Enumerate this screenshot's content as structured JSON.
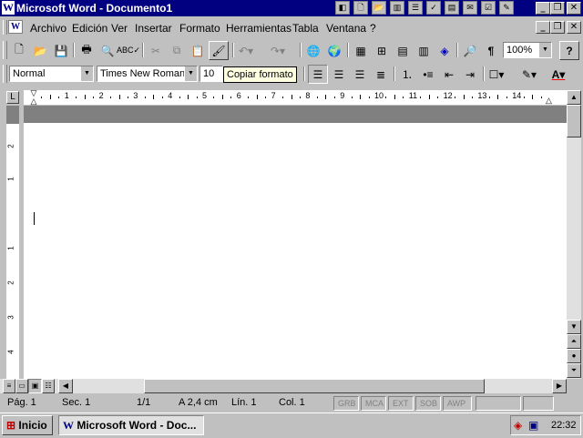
{
  "window": {
    "title": "Microsoft Word - Documento1",
    "icon": "W"
  },
  "office_bar_icons": [
    "office-logo-icon",
    "new-doc-icon",
    "open-icon",
    "binder-icon",
    "contact-icon",
    "note-icon",
    "task-icon",
    "journal-icon",
    "shortcut-icon",
    "folder-icon"
  ],
  "menu": {
    "items": [
      "Archivo",
      "Edición",
      "Ver",
      "Insertar",
      "Formato",
      "Herramientas",
      "Tabla",
      "Ventana",
      "?"
    ]
  },
  "standard_toolbar": {
    "zoom": "100%",
    "help_glyph": "?"
  },
  "format_toolbar": {
    "style": "Normal",
    "font": "Times New Roman",
    "size": "10"
  },
  "tooltip": "Copiar formato",
  "ruler": {
    "labels": [
      "1",
      "2",
      "3",
      "4",
      "5",
      "6",
      "7",
      "8",
      "9",
      "10",
      "11",
      "12",
      "13",
      "14"
    ],
    "vertical_labels": [
      "2",
      "1",
      "1",
      "2",
      "3",
      "4"
    ]
  },
  "statusbar": {
    "page": "Pág.  1",
    "section": "Sec.  1",
    "pages": "1/1",
    "position": "A  2,4 cm",
    "line": "Lín.  1",
    "column": "Col.  1",
    "modes": [
      "GRB",
      "MCA",
      "EXT",
      "SOB",
      "AWP"
    ]
  },
  "taskbar": {
    "start": "Inicio",
    "task": "Microsoft Word - Doc...",
    "clock": "22:32"
  },
  "colors": {
    "titlebar": "#000080",
    "face": "#c0c0c0",
    "tooltip": "#ffffe1"
  }
}
